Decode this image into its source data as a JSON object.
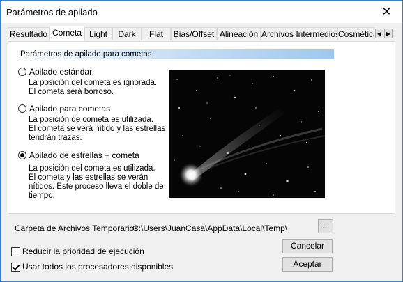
{
  "window": {
    "title": "Parámetros de apilado"
  },
  "tabs": [
    {
      "label": "Resultado"
    },
    {
      "label": "Cometa",
      "active": true
    },
    {
      "label": "Light"
    },
    {
      "label": "Dark"
    },
    {
      "label": "Flat"
    },
    {
      "label": "Bias/Offset"
    },
    {
      "label": "Alineación"
    },
    {
      "label": "Archivos Intermedios"
    },
    {
      "label": "Cosmética"
    }
  ],
  "panel": {
    "section_title": "Parámetros de apilado para cometas",
    "options": [
      {
        "label": "Apilado estándar",
        "checked": false,
        "description": "La posición del cometa es ignorada.\nEl cometa será borroso."
      },
      {
        "label": "Apilado para cometas",
        "checked": false,
        "description": "La posición de cometa es utilizada.\nEl cometa se verá nítido y las estrellas\ntendrán trazas."
      },
      {
        "label": "Apilado de estrellas + cometa",
        "checked": true,
        "description": "La posición del cometa es utilizada.\n El cometa y las estrellas se verán\nnítidos. Este proceso lleva el doble de\ntiempo."
      }
    ]
  },
  "temp": {
    "label": "Carpeta de Archivos Temporarios:",
    "path": "C:\\Users\\JuanCasa\\AppData\\Local\\Temp\\",
    "browse_label": "..."
  },
  "checkboxes": [
    {
      "label": "Reducir la prioridad de ejecución",
      "checked": false
    },
    {
      "label": "Usar todos los procesadores disponibles",
      "checked": true
    }
  ],
  "buttons": {
    "cancel": "Cancelar",
    "accept": "Aceptar"
  },
  "icons": {
    "close": "close-icon",
    "scroll_left": "chevron-left-icon",
    "scroll_right": "chevron-right-icon"
  }
}
